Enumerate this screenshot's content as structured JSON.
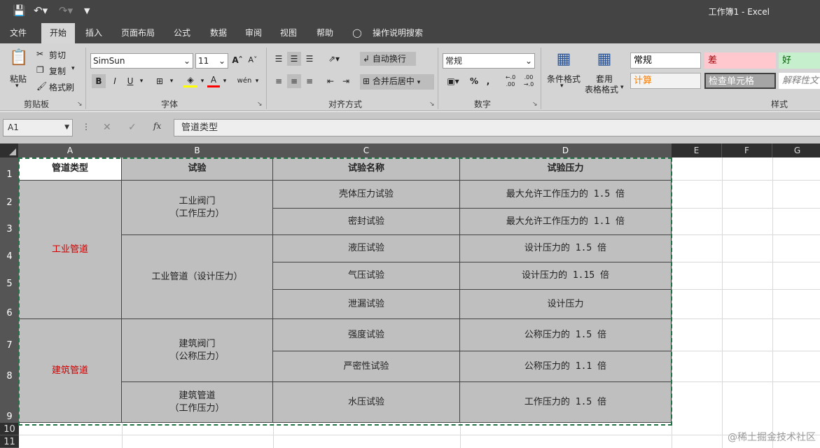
{
  "window": {
    "title": "工作簿1  -  Excel"
  },
  "menu_tabs": [
    {
      "label": "文件",
      "active": false
    },
    {
      "label": "开始",
      "active": true
    },
    {
      "label": "插入",
      "active": false
    },
    {
      "label": "页面布局",
      "active": false
    },
    {
      "label": "公式",
      "active": false
    },
    {
      "label": "数据",
      "active": false
    },
    {
      "label": "审阅",
      "active": false
    },
    {
      "label": "视图",
      "active": false
    },
    {
      "label": "帮助",
      "active": false
    }
  ],
  "tell_me": "操作说明搜索",
  "ribbon": {
    "clipboard": {
      "paste": "粘贴",
      "cut": "剪切",
      "copy": "复制",
      "format_painter": "格式刷",
      "group": "剪贴板"
    },
    "font": {
      "name": "SimSun",
      "size": "11",
      "bold": "B",
      "italic": "I",
      "underline": "U",
      "group": "字体"
    },
    "alignment": {
      "wrap": "自动换行",
      "merge": "合并后居中",
      "group": "对齐方式"
    },
    "number": {
      "format": "常规",
      "group": "数字"
    },
    "styles": {
      "conditional": "条件格式",
      "table1": "套用",
      "table2": "表格格式",
      "cells": [
        {
          "label": "常规",
          "bg": "#ffffff",
          "fg": "#000000"
        },
        {
          "label": "差",
          "bg": "#ffc7ce",
          "fg": "#9c0006"
        },
        {
          "label": "好",
          "bg": "#c6efce",
          "fg": "#006100"
        },
        {
          "label": "计算",
          "bg": "#f2f2f2",
          "fg": "#fa7d00"
        },
        {
          "label": "检查单元格",
          "bg": "#a5a5a5",
          "fg": "#ffffff"
        },
        {
          "label": "解释性文",
          "bg": "#ffffff",
          "fg": "#7f7f7f"
        }
      ],
      "group": "样式"
    }
  },
  "formula_bar": {
    "name_box": "A1",
    "fx": "fx",
    "content": "管道类型"
  },
  "columns": [
    "A",
    "B",
    "C",
    "D",
    "E",
    "F",
    "G"
  ],
  "rows": [
    "1",
    "2",
    "3",
    "4",
    "5",
    "6",
    "7",
    "8",
    "9",
    "10",
    "11"
  ],
  "table": {
    "headers": [
      "管道类型",
      "试验",
      "试验名称",
      "试验压力"
    ],
    "a_groups": [
      "工业管道",
      "建筑管道"
    ],
    "b_groups": [
      "工业阀门\n（工作压力）",
      "工业管道（设计压力）",
      "建筑阀门\n（公称压力）",
      "建筑管道\n（工作压力）"
    ],
    "c_values": [
      "壳体压力试验",
      "密封试验",
      "液压试验",
      "气压试验",
      "泄漏试验",
      "强度试验",
      "严密性试验",
      "水压试验"
    ],
    "d_values": [
      "最大允许工作压力的 1.5 倍",
      "最大允许工作压力的 1.1 倍",
      "设计压力的 1.5 倍",
      "设计压力的 1.15 倍",
      "设计压力",
      "公称压力的 1.5 倍",
      "公称压力的 1.1 倍",
      "工作压力的 1.5 倍"
    ]
  },
  "watermark": "@稀土掘金技术社区",
  "colors": {
    "selection_border": "#217346",
    "red_text": "#d00000",
    "cell_fill": "#bfbfbf"
  }
}
